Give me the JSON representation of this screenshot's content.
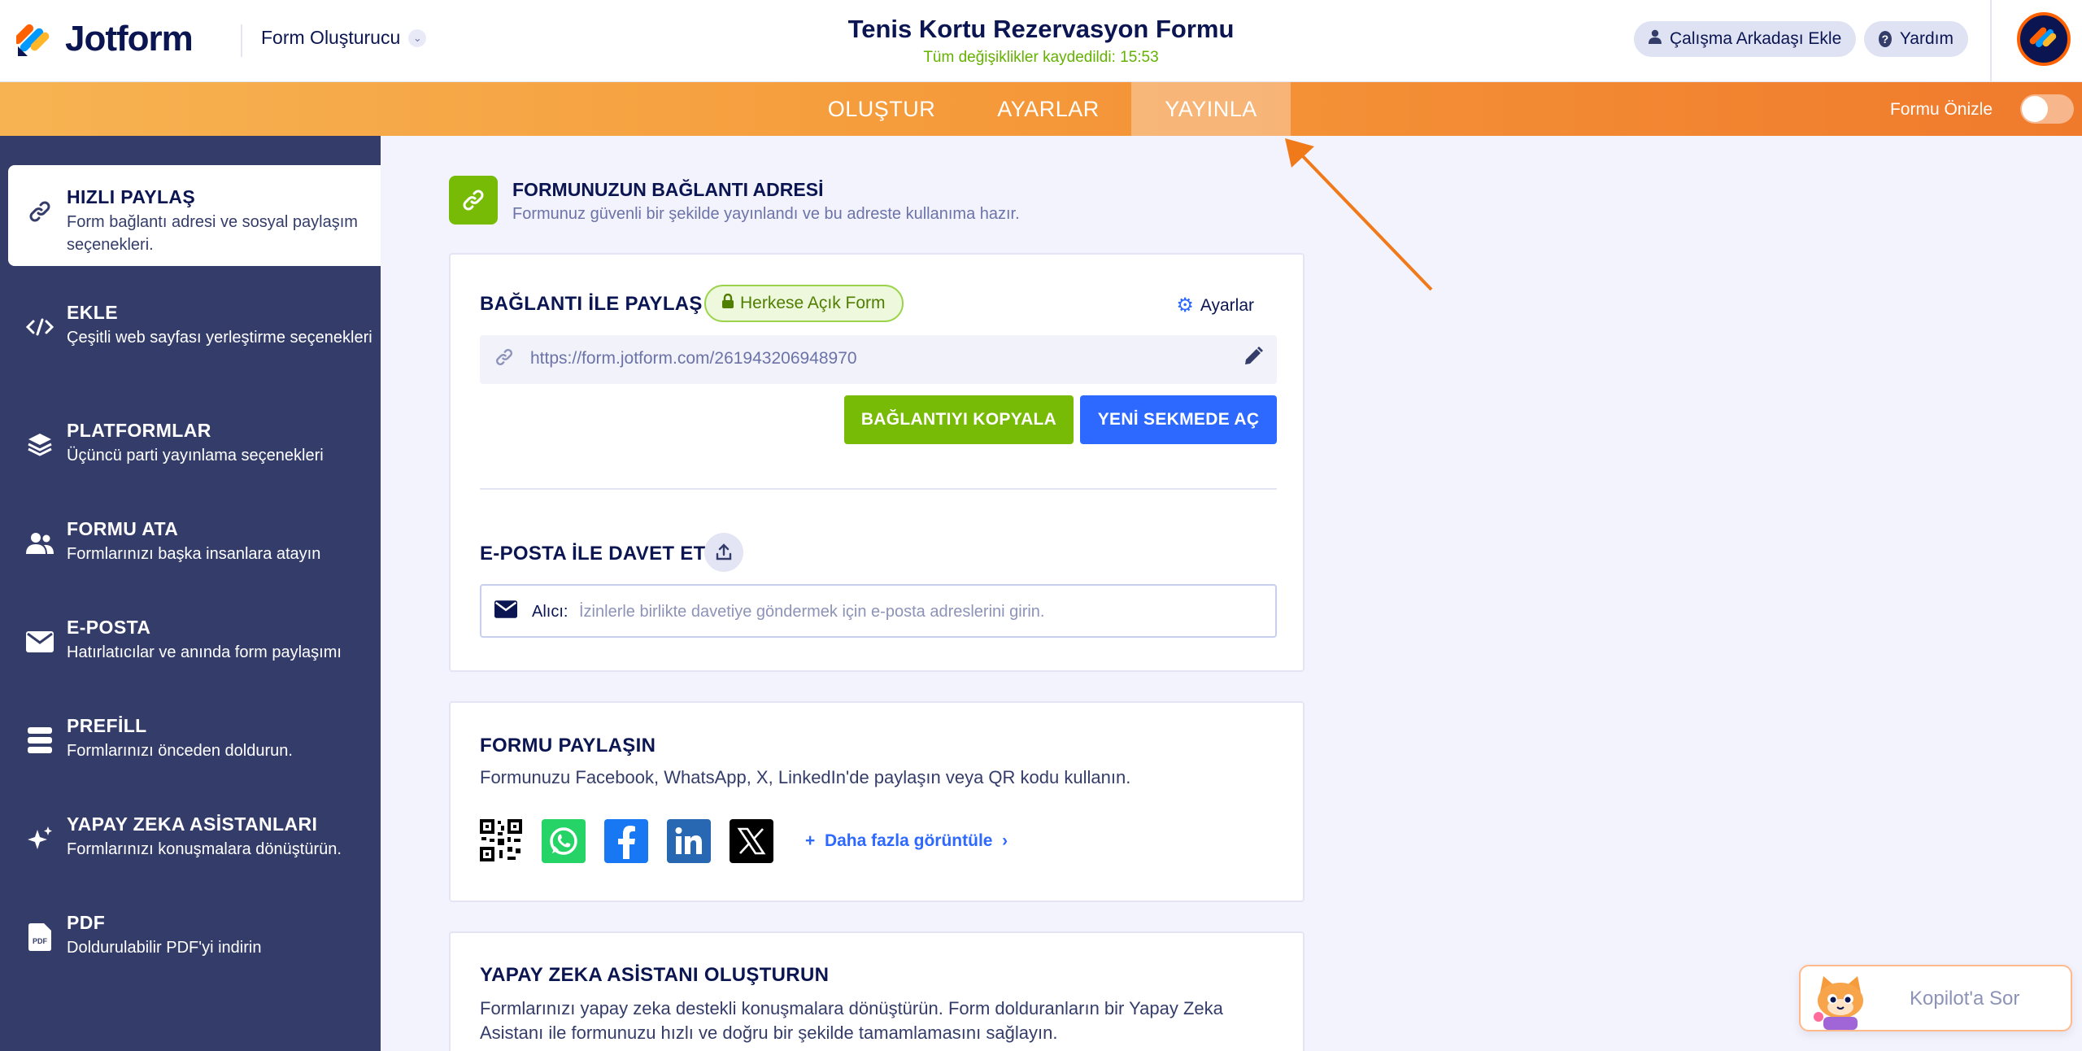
{
  "header": {
    "logo_text": "Jotform",
    "builder_label": "Form Oluşturucu",
    "form_title": "Tenis Kortu Rezervasyon Formu",
    "save_status": "Tüm değişiklikler kaydedildi: 15:53",
    "add_collaborator": "Çalışma Arkadaşı Ekle",
    "help": "Yardım"
  },
  "nav": {
    "tabs": [
      {
        "label": "OLUŞTUR"
      },
      {
        "label": "AYARLAR"
      },
      {
        "label": "YAYINLA",
        "active": true
      }
    ],
    "preview_label": "Formu Önizle",
    "preview_on": false
  },
  "sidebar": {
    "items": [
      {
        "title": "HIZLI PAYLAŞ",
        "desc": "Form bağlantı adresi ve sosyal paylaşım seçenekleri.",
        "icon": "link-icon",
        "active": true
      },
      {
        "title": "EKLE",
        "desc": "Çeşitli web sayfası yerleştirme seçenekleri",
        "icon": "code-icon"
      },
      {
        "title": "PLATFORMLAR",
        "desc": "Üçüncü parti yayınlama seçenekleri",
        "icon": "layers-icon"
      },
      {
        "title": "FORMU ATA",
        "desc": "Formlarınızı başka insanlara atayın",
        "icon": "users-icon"
      },
      {
        "title": "E-POSTA",
        "desc": "Hatırlatıcılar ve anında form paylaşımı",
        "icon": "envelope-icon"
      },
      {
        "title": "PREFİLL",
        "desc": "Formlarınızı önceden doldurun.",
        "icon": "database-icon"
      },
      {
        "title": "YAPAY ZEKA ASİSTANLARI",
        "desc": "Formlarınızı konuşmalara dönüştürün.",
        "icon": "sparkles-icon"
      },
      {
        "title": "PDF",
        "desc": "Doldurulabilir PDF'yi indirin",
        "icon": "pdf-icon"
      }
    ]
  },
  "main": {
    "section_title": "FORMUNUZUN BAĞLANTI ADRESİ",
    "section_sub": "Formunuz güvenli bir şekilde yayınlandı ve bu adreste kullanıma hazır.",
    "link_card": {
      "title": "BAĞLANTI İLE PAYLAŞ",
      "public_pill": "Herkese Açık Form",
      "settings": "Ayarlar",
      "url": "https://form.jotform.com/261943206948970",
      "copy_button": "BAĞLANTIYI KOPYALA",
      "open_button": "YENİ SEKMEDE AÇ",
      "email_title": "E-POSTA İLE DAVET ET",
      "recipient_label": "Alıcı:",
      "recipient_placeholder": "İzinlerle birlikte davetiye göndermek için e-posta adreslerini girin."
    },
    "share_card": {
      "title": "FORMU PAYLAŞIN",
      "text": "Formunuzu Facebook, WhatsApp, X, LinkedIn'de paylaşın veya QR kodu kullanın.",
      "more": "Daha fazla görüntüle"
    },
    "ai_card": {
      "title": "YAPAY ZEKA ASİSTANI OLUŞTURUN",
      "text": "Formlarınızı yapay zeka destekli konuşmalara dönüştürün. Form dolduranların bir Yapay Zeka Asistanı ile formunuzu hızlı ve doğru bir şekilde tamamlamasını sağlayın."
    }
  },
  "kopilot": {
    "label": "Kopilot'a Sor"
  },
  "colors": {
    "accent_orange": "#f59b3b",
    "green": "#78bb07",
    "blue": "#2e69ff",
    "navy": "#0a1551",
    "sidebar": "#343c6a"
  }
}
